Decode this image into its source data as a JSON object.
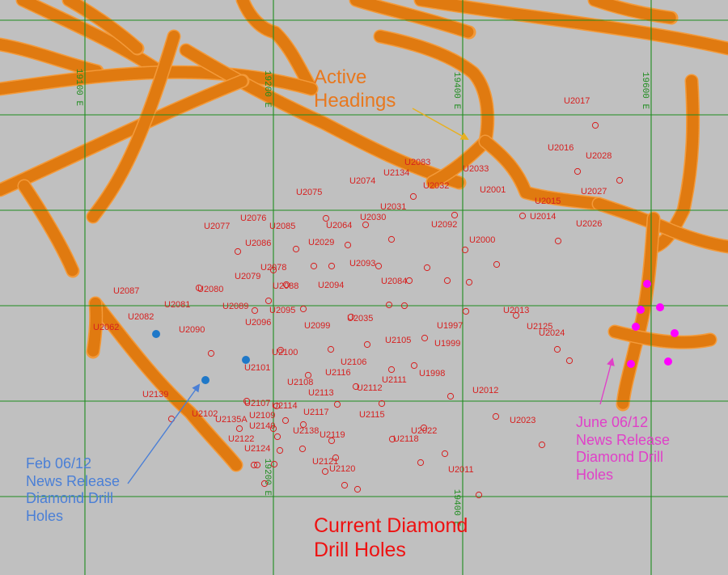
{
  "labels": {
    "active_headings": [
      "Active",
      "Headings"
    ],
    "feb_release": [
      "Feb 06/12",
      "News Release",
      "Diamond Drill",
      "Holes"
    ],
    "june_release": [
      "June 06/12",
      "News Release",
      "Diamond Drill",
      "Holes"
    ],
    "current_holes": [
      "Current Diamond",
      "Drill Holes"
    ]
  },
  "eastings": [
    "19100 E",
    "19200 E",
    "19400 E",
    "19600 E"
  ],
  "colors": {
    "background": "#c0c0c0",
    "workings": "#f39a3a",
    "grid": "#1e8c1e",
    "current_holes": "#d62020",
    "feb_holes": "#1f78c8",
    "june_holes": "#ff00ff",
    "active_headings_text": "#e8781e",
    "feb_text": "#4a7fd6",
    "june_text": "#e040c8",
    "title_text": "#ee1111"
  },
  "hole_labels": [
    "U2017",
    "U2016",
    "U2028",
    "U2083",
    "U2033",
    "U2134",
    "U2074",
    "U2032",
    "U2001",
    "U2027",
    "U2015",
    "U2075",
    "U2014",
    "U2026",
    "U2031",
    "U2076",
    "U2077",
    "U2085",
    "U2064",
    "U2030",
    "U2092",
    "U2029",
    "U2086",
    "U2000",
    "U2093",
    "U2078",
    "U2079",
    "U2080",
    "U2088",
    "U2094",
    "U2087",
    "U2084",
    "U2081",
    "U2089",
    "U2095",
    "U2013",
    "U2082",
    "U2096",
    "U2035",
    "U2062",
    "U2090",
    "U2099",
    "U1997",
    "U2125",
    "U2024",
    "U2105",
    "U1999",
    "U2100",
    "U2101",
    "U2106",
    "U2116",
    "U1998",
    "U2108",
    "U2111",
    "U2112",
    "U2139",
    "U2113",
    "U2012",
    "U2107",
    "U2114",
    "U2102",
    "U2135A",
    "U2109",
    "U2117",
    "U2115",
    "U2023",
    "U2140",
    "U2138",
    "U2022",
    "U2122",
    "U2119",
    "U2118",
    "U2124",
    "U2121",
    "U2120",
    "U2011"
  ]
}
